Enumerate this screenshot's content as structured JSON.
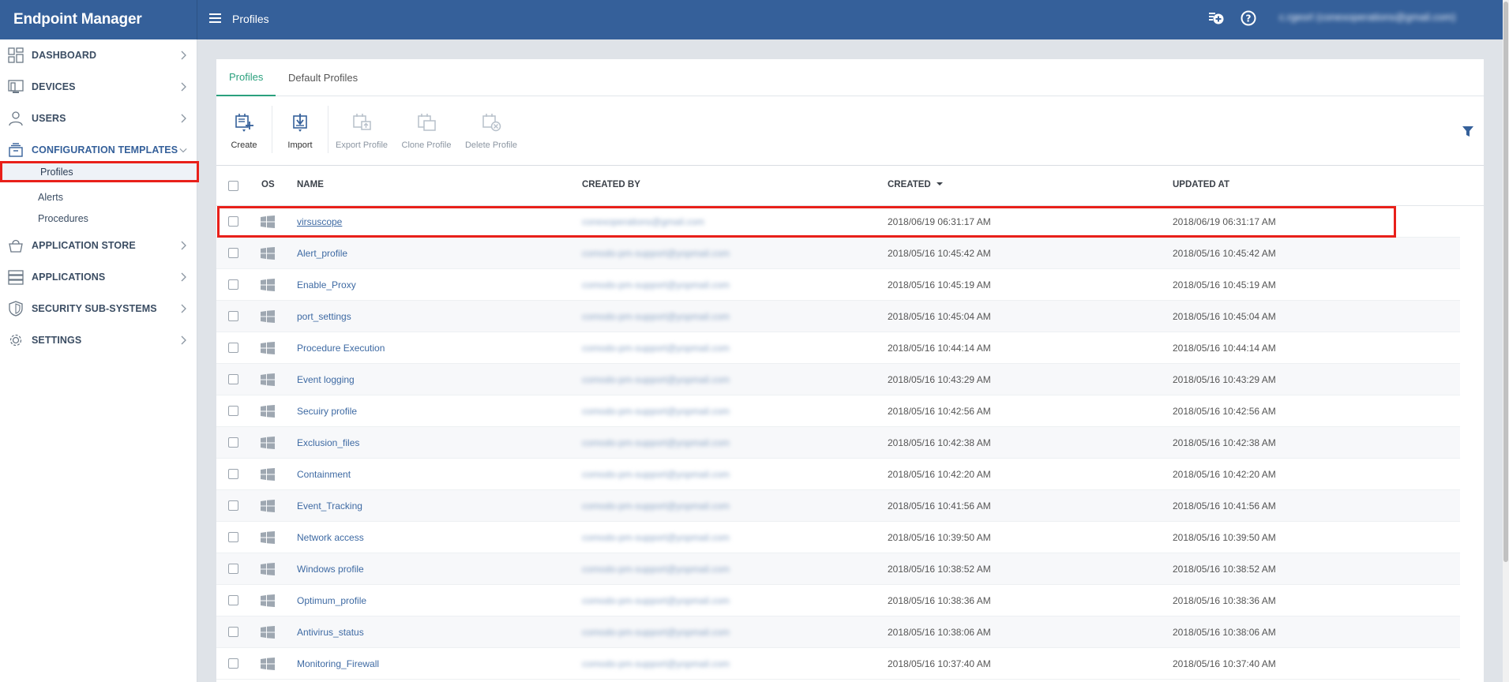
{
  "app": {
    "title": "Endpoint Manager",
    "page_title": "Profiles",
    "user_email": "c.rgeorl (conexoperations@gmail.com)"
  },
  "sidebar": {
    "items": [
      {
        "label": "DASHBOARD",
        "icon": "dashboard-icon"
      },
      {
        "label": "DEVICES",
        "icon": "devices-icon"
      },
      {
        "label": "USERS",
        "icon": "user-icon"
      },
      {
        "label": "CONFIGURATION TEMPLATES",
        "icon": "templates-icon",
        "expanded": true
      },
      {
        "label": "APPLICATION STORE",
        "icon": "basket-icon"
      },
      {
        "label": "APPLICATIONS",
        "icon": "applications-icon"
      },
      {
        "label": "SECURITY SUB-SYSTEMS",
        "icon": "shield-icon"
      },
      {
        "label": "SETTINGS",
        "icon": "gear-icon"
      }
    ],
    "subitems": [
      {
        "label": "Profiles",
        "active": true
      },
      {
        "label": "Alerts"
      },
      {
        "label": "Procedures"
      }
    ]
  },
  "tabs": [
    {
      "label": "Profiles",
      "active": true
    },
    {
      "label": "Default Profiles"
    }
  ],
  "toolbar": {
    "create": "Create",
    "import": "Import",
    "export": "Export Profile",
    "clone": "Clone Profile",
    "delete": "Delete Profile"
  },
  "table": {
    "headers": {
      "os": "OS",
      "name": "NAME",
      "created_by": "CREATED BY",
      "created": "CREATED",
      "updated_at": "UPDATED AT"
    },
    "sort_column": "CREATED",
    "sort_direction": "descending",
    "rows": [
      {
        "name": "virsuscope",
        "created_by": "conexoperations@gmail.com",
        "created": "2018/06/19 06:31:17 AM",
        "updated_at": "2018/06/19 06:31:17 AM",
        "highlighted": true
      },
      {
        "name": "Alert_profile",
        "created_by": "comodo-pm-support@yopmail.com",
        "created": "2018/05/16 10:45:42 AM",
        "updated_at": "2018/05/16 10:45:42 AM"
      },
      {
        "name": "Enable_Proxy",
        "created_by": "comodo-pm-support@yopmail.com",
        "created": "2018/05/16 10:45:19 AM",
        "updated_at": "2018/05/16 10:45:19 AM"
      },
      {
        "name": "port_settings",
        "created_by": "comodo-pm-support@yopmail.com",
        "created": "2018/05/16 10:45:04 AM",
        "updated_at": "2018/05/16 10:45:04 AM"
      },
      {
        "name": "Procedure Execution",
        "created_by": "comodo-pm-support@yopmail.com",
        "created": "2018/05/16 10:44:14 AM",
        "updated_at": "2018/05/16 10:44:14 AM"
      },
      {
        "name": "Event logging",
        "created_by": "comodo-pm-support@yopmail.com",
        "created": "2018/05/16 10:43:29 AM",
        "updated_at": "2018/05/16 10:43:29 AM"
      },
      {
        "name": "Secuiry profile",
        "created_by": "comodo-pm-support@yopmail.com",
        "created": "2018/05/16 10:42:56 AM",
        "updated_at": "2018/05/16 10:42:56 AM"
      },
      {
        "name": "Exclusion_files",
        "created_by": "comodo-pm-support@yopmail.com",
        "created": "2018/05/16 10:42:38 AM",
        "updated_at": "2018/05/16 10:42:38 AM"
      },
      {
        "name": "Containment",
        "created_by": "comodo-pm-support@yopmail.com",
        "created": "2018/05/16 10:42:20 AM",
        "updated_at": "2018/05/16 10:42:20 AM"
      },
      {
        "name": "Event_Tracking",
        "created_by": "comodo-pm-support@yopmail.com",
        "created": "2018/05/16 10:41:56 AM",
        "updated_at": "2018/05/16 10:41:56 AM"
      },
      {
        "name": "Network access",
        "created_by": "comodo-pm-support@yopmail.com",
        "created": "2018/05/16 10:39:50 AM",
        "updated_at": "2018/05/16 10:39:50 AM"
      },
      {
        "name": "Windows profile",
        "created_by": "comodo-pm-support@yopmail.com",
        "created": "2018/05/16 10:38:52 AM",
        "updated_at": "2018/05/16 10:38:52 AM"
      },
      {
        "name": "Optimum_profile",
        "created_by": "comodo-pm-support@yopmail.com",
        "created": "2018/05/16 10:38:36 AM",
        "updated_at": "2018/05/16 10:38:36 AM"
      },
      {
        "name": "Antivirus_status",
        "created_by": "comodo-pm-support@yopmail.com",
        "created": "2018/05/16 10:38:06 AM",
        "updated_at": "2018/05/16 10:38:06 AM"
      },
      {
        "name": "Monitoring_Firewall",
        "created_by": "comodo-pm-support@yopmail.com",
        "created": "2018/05/16 10:37:40 AM",
        "updated_at": "2018/05/16 10:37:40 AM"
      }
    ]
  },
  "colors": {
    "header_bg": "#35609a",
    "accent_tab": "#2aa07d",
    "link": "#3e6aa3",
    "highlight": "#e8201a"
  }
}
